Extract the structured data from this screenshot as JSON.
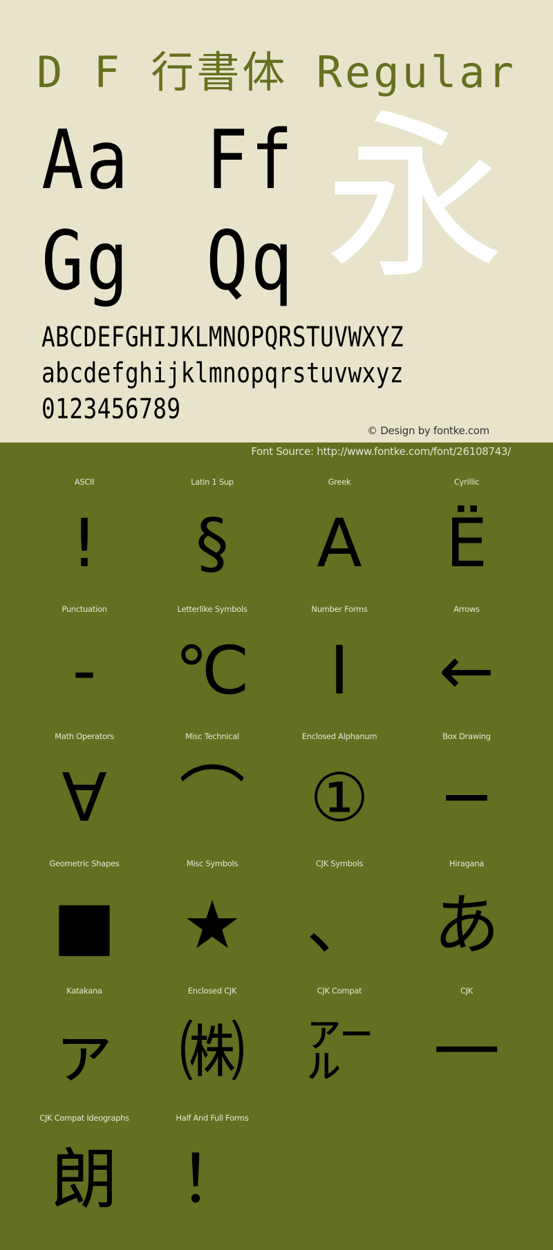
{
  "colors": {
    "top_background": "#e8e4cc",
    "bottom_background": "#636f21",
    "title": "#66701f",
    "hero_glyph": "#ffffff",
    "specimen_text": "#000000",
    "label_text": "#e8e8d8"
  },
  "header": {
    "title": "D F 行書体 Regular"
  },
  "specimen": {
    "pairs": [
      "Aa",
      "Ff",
      "Gg",
      "Qq"
    ],
    "hero_glyph": "永",
    "uppercase": "ABCDEFGHIJKLMNOPQRSTUVWXYZ",
    "lowercase": "abcdefghijklmnopqrstuvwxyz",
    "digits": "0123456789",
    "copyright": "© Design by fontke.com"
  },
  "source": {
    "text": "Font Source: http://www.fontke.com/font/26108743/"
  },
  "blocks": [
    {
      "label": "ASCII",
      "glyph": "!"
    },
    {
      "label": "Latin 1 Sup",
      "glyph": "§"
    },
    {
      "label": "Greek",
      "glyph": "Α"
    },
    {
      "label": "Cyrillic",
      "glyph": "Ё"
    },
    {
      "label": "Punctuation",
      "glyph": "‐"
    },
    {
      "label": "Letterlike Symbols",
      "glyph": "℃"
    },
    {
      "label": "Number Forms",
      "glyph": "Ⅰ"
    },
    {
      "label": "Arrows",
      "glyph": "←"
    },
    {
      "label": "Math Operators",
      "glyph": "∀"
    },
    {
      "label": "Misc Technical",
      "glyph": "⌒"
    },
    {
      "label": "Enclosed Alphanum",
      "glyph": "①"
    },
    {
      "label": "Box Drawing",
      "glyph": "─"
    },
    {
      "label": "Geometric Shapes",
      "glyph": "■"
    },
    {
      "label": "Misc Symbols",
      "glyph": "★"
    },
    {
      "label": "CJK Symbols",
      "glyph": "、"
    },
    {
      "label": "Hiragana",
      "glyph": "あ"
    },
    {
      "label": "Katakana",
      "glyph": "ァ"
    },
    {
      "label": "Enclosed CJK",
      "glyph": "㈱"
    },
    {
      "label": "CJK Compat",
      "glyph": "㌃"
    },
    {
      "label": "CJK",
      "glyph": "一"
    },
    {
      "label": "CJK Compat Ideographs",
      "glyph": "朗"
    },
    {
      "label": "Half And Full Forms",
      "glyph": "！"
    }
  ]
}
